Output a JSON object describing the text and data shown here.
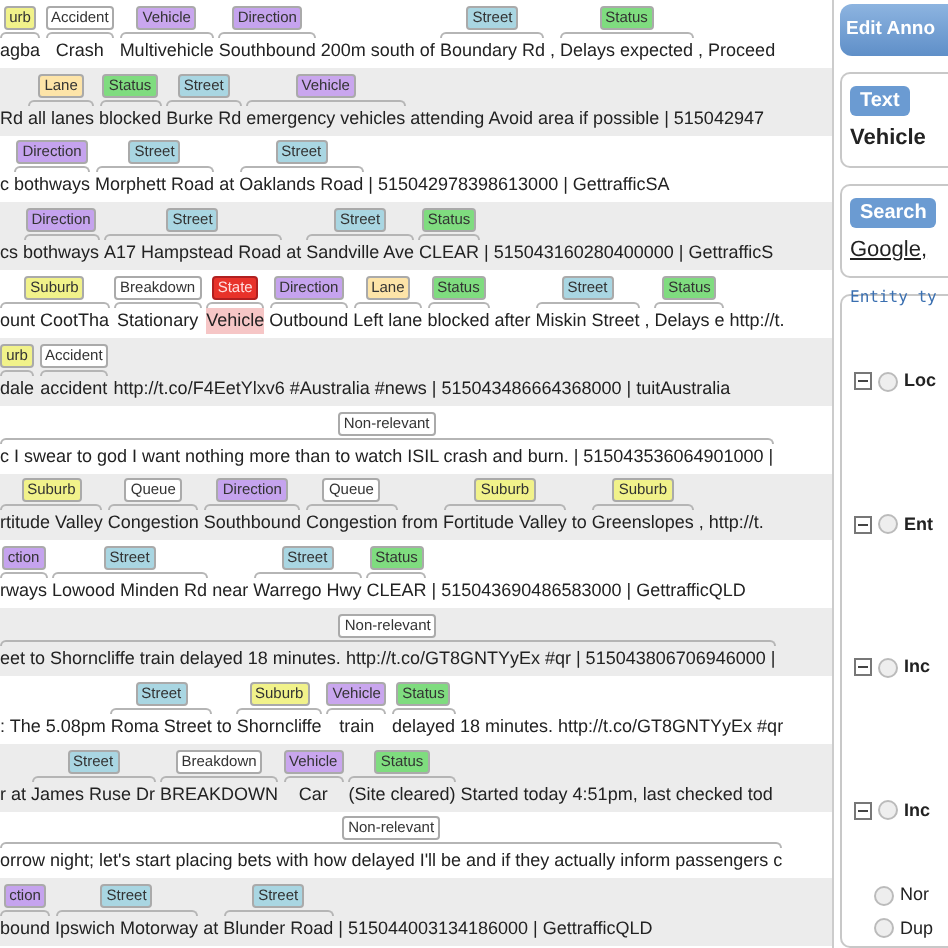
{
  "rows": [
    {
      "segments": [
        {
          "text": "agba",
          "label": "urb",
          "color": "#f1f28a"
        },
        {
          "text": "Crash",
          "label": "Accident",
          "color": "#ffffff"
        },
        {
          "text": "Multivehicle",
          "label": "Vehicle",
          "color": "#c9a6ee"
        },
        {
          "text": "Southbound",
          "label": "Direction",
          "color": "#c5a3ee"
        },
        {
          "text": "200m south of"
        },
        {
          "text": "Boundary Rd",
          "label": "Street",
          "color": "#a9d6e2"
        },
        {
          "text": ","
        },
        {
          "text": "Delays expected",
          "label": "Status",
          "color": "#7fdc7f"
        },
        {
          "text": ", Proceed"
        }
      ]
    },
    {
      "segments": [
        {
          "text": "Rd"
        },
        {
          "text": "all lanes",
          "label": "Lane",
          "color": "#fde4a8"
        },
        {
          "text": "blocked",
          "label": "Status",
          "color": "#7fdc7f"
        },
        {
          "text": "Burke Rd",
          "label": "Street",
          "color": "#a9d6e2"
        },
        {
          "text": "emergency vehicles",
          "label": "Vehicle",
          "color": "#c9a6ee"
        },
        {
          "text": "attending  Avoid area if possible | 515042947"
        }
      ]
    },
    {
      "segments": [
        {
          "text": "c"
        },
        {
          "text": "bothways",
          "label": "Direction",
          "color": "#c5a3ee"
        },
        {
          "text": "Morphett Road",
          "label": "Street",
          "color": "#a9d6e2"
        },
        {
          "text": "at"
        },
        {
          "text": "Oaklands Road",
          "label": "Street",
          "color": "#a9d6e2"
        },
        {
          "text": "| 515042978398613000 | GettrafficSA"
        }
      ]
    },
    {
      "segments": [
        {
          "text": "cs"
        },
        {
          "text": "bothways",
          "label": "Direction",
          "color": "#c5a3ee"
        },
        {
          "text": "A17 Hampstead Road",
          "label": "Street",
          "color": "#a9d6e2"
        },
        {
          "text": "at"
        },
        {
          "text": "Sandville Ave",
          "label": "Street",
          "color": "#a9d6e2"
        },
        {
          "text": "CLEAR",
          "label": "Status",
          "color": "#7fdc7f"
        },
        {
          "text": "| 515043160280400000 | GettrafficS"
        }
      ]
    },
    {
      "segments": [
        {
          "text": "ount CootTha",
          "label": "Suburb",
          "color": "#f1f28a"
        },
        {
          "text": "Stationary",
          "label": "Breakdown",
          "color": "#ffffff"
        },
        {
          "text": "Vehicle",
          "label": "State",
          "color": "#e8322a"
        },
        {
          "text": "Outbound",
          "label": "Direction",
          "color": "#c5a3ee"
        },
        {
          "text": "Left lane",
          "label": "Lane",
          "color": "#fde4a8"
        },
        {
          "text": "blocked",
          "label": "Status",
          "color": "#7fdc7f"
        },
        {
          "text": "after"
        },
        {
          "text": "Miskin Street",
          "label": "Street",
          "color": "#a9d6e2"
        },
        {
          "text": ","
        },
        {
          "text": "Delays e",
          "label": "Status",
          "color": "#7fdc7f"
        },
        {
          "text": "http://t."
        }
      ]
    },
    {
      "segments": [
        {
          "text": "dale",
          "label": "urb",
          "color": "#f1f28a"
        },
        {
          "text": "accident",
          "label": "Accident",
          "color": "#ffffff"
        },
        {
          "text": "http://t.co/F4EetYlxv6 #Australia #news | 515043486664368000 | tuitAustralia"
        }
      ]
    },
    {
      "segments": [
        {
          "text": "c I swear to god I want nothing more than to watch ISIL crash and burn. | 515043536064901000 |",
          "label": "Non-relevant",
          "color": "#ffffff"
        }
      ]
    },
    {
      "segments": [
        {
          "text": "rtitude Valley",
          "label": "Suburb",
          "color": "#f1f28a"
        },
        {
          "text": "Congestion",
          "label": "Queue",
          "color": "#ffffff"
        },
        {
          "text": "Southbound",
          "label": "Direction",
          "color": "#c5a3ee"
        },
        {
          "text": "Congestion",
          "label": "Queue",
          "color": "#ffffff"
        },
        {
          "text": "from"
        },
        {
          "text": "Fortitude Valley",
          "label": "Suburb",
          "color": "#f1f28a"
        },
        {
          "text": "to"
        },
        {
          "text": "Greenslopes",
          "label": "Suburb",
          "color": "#f1f28a"
        },
        {
          "text": ",  http://t."
        }
      ]
    },
    {
      "segments": [
        {
          "text": "rways",
          "label": "ction",
          "color": "#c5a3ee"
        },
        {
          "text": "Lowood Minden Rd",
          "label": "Street",
          "color": "#a9d6e2"
        },
        {
          "text": "near"
        },
        {
          "text": "Warrego Hwy",
          "label": "Street",
          "color": "#a9d6e2"
        },
        {
          "text": "CLEAR",
          "label": "Status",
          "color": "#7fdc7f"
        },
        {
          "text": "| 515043690486583000 | GettrafficQLD"
        }
      ]
    },
    {
      "segments": [
        {
          "text": "eet to Shorncliffe train delayed 18 minutes. http://t.co/GT8GNTYyEx #qr | 515043806706946000 |",
          "label": "Non-relevant",
          "color": "#ffffff"
        }
      ]
    },
    {
      "segments": [
        {
          "text": ": The 5.08pm"
        },
        {
          "text": "Roma Street",
          "label": "Street",
          "color": "#a9d6e2"
        },
        {
          "text": "to"
        },
        {
          "text": "Shorncliffe",
          "label": "Suburb",
          "color": "#f1f28a"
        },
        {
          "text": "train",
          "label": "Vehicle",
          "color": "#c9a6ee"
        },
        {
          "text": "delayed",
          "label": "Status",
          "color": "#7fdc7f"
        },
        {
          "text": "18 minutes. http://t.co/GT8GNTYyEx #qr"
        }
      ]
    },
    {
      "segments": [
        {
          "text": "r at"
        },
        {
          "text": "James Ruse Dr",
          "label": "Street",
          "color": "#a9d6e2"
        },
        {
          "text": "BREAKDOWN",
          "label": "Breakdown",
          "color": "#ffffff"
        },
        {
          "text": "Car",
          "label": "Vehicle",
          "color": "#c9a6ee"
        },
        {
          "text": "(Site cleared)",
          "label": "Status",
          "color": "#7fdc7f"
        },
        {
          "text": "Started today 4:51pm, last checked tod"
        }
      ]
    },
    {
      "segments": [
        {
          "text": "orrow night; let's start placing bets with how delayed I'll be and if they actually inform passengers c",
          "label": "Non-relevant",
          "color": "#ffffff"
        }
      ]
    },
    {
      "segments": [
        {
          "text": "bound",
          "label": "ction",
          "color": "#c5a3ee"
        },
        {
          "text": "Ipswich Motorway",
          "label": "Street",
          "color": "#a9d6e2"
        },
        {
          "text": "at"
        },
        {
          "text": "Blunder Road",
          "label": "Street",
          "color": "#a9d6e2"
        },
        {
          "text": "| 515044003134186000 | GettrafficQLD"
        }
      ]
    }
  ],
  "panel": {
    "title": "Edit Anno",
    "text_field": {
      "legend": "Text",
      "value": "Vehicle"
    },
    "search": {
      "legend": "Search",
      "link": "Google,"
    },
    "entity_types": {
      "legend": "Entity ty",
      "groups": [
        {
          "label": "Loc",
          "expanded": true,
          "selected": false
        },
        {
          "label": "Ent",
          "expanded": true,
          "selected": false
        },
        {
          "label": "Inc",
          "expanded": true,
          "selected": false
        },
        {
          "label": "Inc",
          "expanded": true,
          "selected": false
        }
      ],
      "options": [
        {
          "label": "Nor",
          "selected": false
        },
        {
          "label": "Dup",
          "selected": false
        }
      ]
    }
  }
}
